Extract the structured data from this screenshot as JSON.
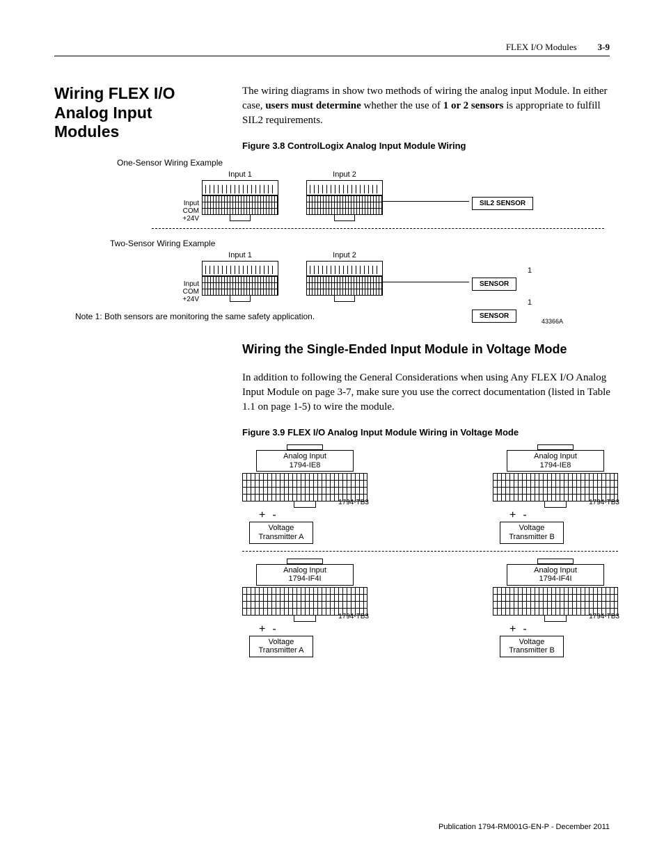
{
  "header": {
    "doc_section": "FLEX I/O Modules",
    "page_num": "3-9"
  },
  "section": {
    "title": "Wiring FLEX I/O Analog Input Modules",
    "intro_1": "The wiring diagrams in   show two methods of wiring the analog input Module. In either case, ",
    "intro_bold": "users must determine",
    "intro_2": " whether the use of ",
    "intro_bold2": "1 or 2 sensors",
    "intro_3": " is appropriate to fulfill SIL2 requirements."
  },
  "fig38": {
    "caption": "Figure 3.8 ControlLogix Analog Input Module Wiring",
    "one_sensor_title": "One-Sensor Wiring Example",
    "two_sensor_title": "Two-Sensor Wiring Example",
    "input1": "Input 1",
    "input2": "Input 2",
    "row_labels": {
      "input": "Input",
      "com": "COM",
      "v24": "+24V"
    },
    "sil2_sensor": "SIL2 SENSOR",
    "sensor": "SENSOR",
    "note1_ref": "1",
    "note1": "Note 1: Both sensors are monitoring the same safety application.",
    "ref": "43366A"
  },
  "subsection": {
    "title": "Wiring the Single-Ended Input Module in Voltage Mode",
    "body": "In addition to following the General Considerations when using Any FLEX I/O Analog Input Module on page 3-7, make sure you use the correct documentation (listed in Table 1.1 on page 1-5) to wire the module."
  },
  "fig39": {
    "caption": "Figure 3.9 FLEX I/O Analog Input Module Wiring in Voltage Mode",
    "mod_ie8_l1": "Analog Input",
    "mod_ie8_l2": "1794-IE8",
    "mod_if4i_l1": "Analog Input",
    "mod_if4i_l2": "1794-IF4I",
    "tb_label": "1794-TB3",
    "plus": "+",
    "minus": "-",
    "vt_a_l1": "Voltage",
    "vt_a_l2": "Transmitter A",
    "vt_b_l1": "Voltage",
    "vt_b_l2": "Transmitter B"
  },
  "footer": {
    "pub": "Publication 1794-RM001G-EN-P - December 2011"
  }
}
